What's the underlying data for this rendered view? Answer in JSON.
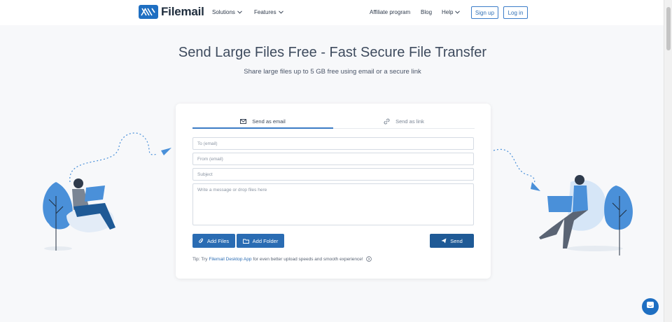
{
  "header": {
    "brand": "Filemail",
    "nav": {
      "solutions": "Solutions",
      "features": "Features",
      "affiliate": "Affiliate program",
      "blog": "Blog",
      "help": "Help"
    },
    "signup": "Sign up",
    "login": "Log in"
  },
  "hero": {
    "title": "Send Large Files Free - Fast Secure File Transfer",
    "subtitle": "Share large files up to 5 GB free using email or a secure link"
  },
  "form": {
    "tabs": {
      "email": "Send as email",
      "link": "Send as link"
    },
    "fields": {
      "to": "To (email)",
      "from": "From (email)",
      "subject": "Subject",
      "message": "Write a message or drop files here"
    },
    "buttons": {
      "add_files": "Add Files",
      "add_folder": "Add Folder",
      "send": "Send"
    },
    "tip": {
      "prefix": "Tip: Try",
      "link": "Filemail Desktop App",
      "suffix": "for even better upload speeds and smooth experience!"
    }
  },
  "colors": {
    "accent": "#1f6fc2",
    "send_button": "#1f5a96",
    "active_tab": "#3b7bc5"
  },
  "icons": {
    "logo": "filemail-logo-icon",
    "email_tab": "envelope-icon",
    "link_tab": "link-icon",
    "add_files": "paperclip-icon",
    "add_folder": "folder-icon",
    "send": "paper-plane-icon",
    "tip": "arrow-circle-icon",
    "chat": "chat-icon"
  }
}
